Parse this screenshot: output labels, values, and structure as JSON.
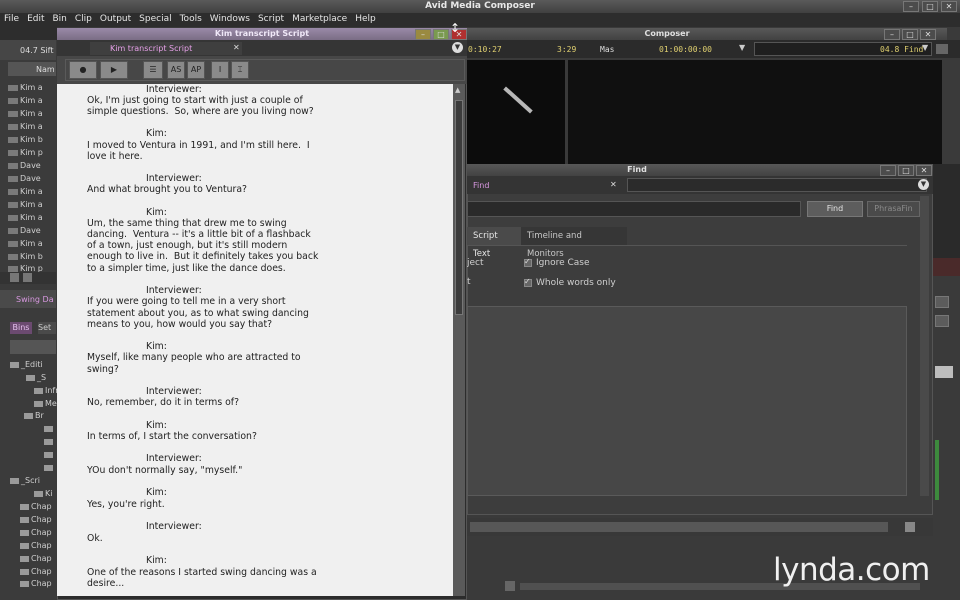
{
  "app": {
    "title": "Avid Media Composer"
  },
  "menu": [
    "File",
    "Edit",
    "Bin",
    "Clip",
    "Output",
    "Special",
    "Tools",
    "Windows",
    "Script",
    "Marketplace",
    "Help"
  ],
  "bin": {
    "header": "04.7 Sift",
    "col": "Nam",
    "items": [
      "Kim a",
      "Kim a",
      "Kim a",
      "Kim a",
      "Kim b",
      "Kim p",
      "Dave",
      "Dave",
      "Kim a",
      "Kim a",
      "Kim a",
      "Dave",
      "Kim a",
      "Kim b",
      "Kim p"
    ]
  },
  "project": {
    "title": "Swing Da",
    "tabs": [
      "Bins",
      "Set"
    ],
    "tree": [
      "_Editi",
      "_S",
      "Infr",
      "Me",
      "Br",
      "",
      "",
      "",
      "",
      "_Scri",
      "Ki",
      "Chap",
      "Chap",
      "Chap",
      "Chap",
      "Chap",
      "Chap",
      "Chap"
    ]
  },
  "script_window": {
    "title": "Kim transcript Script",
    "tab": "Kim transcript Script",
    "buttons": [
      "AS",
      "AP"
    ],
    "lines": [
      {
        "speaker": "Interviewer:",
        "text": [
          "Ok, I'm just going to start with just a couple of",
          "simple questions.  So, where are you living now?"
        ]
      },
      {
        "speaker": "Kim:",
        "text": [
          "I moved to Ventura in 1991, and I'm still here.  I",
          "love it here."
        ]
      },
      {
        "speaker": "Interviewer:",
        "text": [
          "And what brought you to Ventura?"
        ]
      },
      {
        "speaker": "Kim:",
        "text": [
          "Um, the same thing that drew me to swing",
          "dancing.  Ventura -- it's a little bit of a flashback",
          "of a town, just enough, but it's still modern",
          "enough to live in.  But it definitely takes you back",
          "to a simpler time, just like the dance does."
        ]
      },
      {
        "speaker": "Interviewer:",
        "text": [
          "If you were going to tell me in a very short",
          "statement about you, as to what swing dancing",
          "means to you, how would you say that?"
        ]
      },
      {
        "speaker": "Kim:",
        "text": [
          "Myself, like many people who are attracted to",
          "swing?"
        ]
      },
      {
        "speaker": "Interviewer:",
        "text": [
          "No, remember, do it in terms of?"
        ]
      },
      {
        "speaker": "Kim:",
        "text": [
          "In terms of, I start the conversation?"
        ]
      },
      {
        "speaker": "Interviewer:",
        "text": [
          "YOu don't normally say, \"myself.\""
        ]
      },
      {
        "speaker": "Kim:",
        "text": [
          "Yes, you're right."
        ]
      },
      {
        "speaker": "Interviewer:",
        "text": [
          "Ok."
        ]
      },
      {
        "speaker": "Kim:",
        "text": [
          "One of the reasons I started swing dancing was a",
          "desire..."
        ]
      }
    ]
  },
  "composer": {
    "title": "Composer",
    "tc1": "0:10:27",
    "tc2": "3:29",
    "tc3": "Mas",
    "tc4": "01:00:00:00",
    "right_label": "04.8 Find"
  },
  "find": {
    "title": "Find",
    "tab": "Find",
    "button_find": "Find",
    "button_phrase": "PhrasaFin",
    "tabs": [
      "Script Text",
      "Timeline and Monitors"
    ],
    "label_left1": "ject",
    "label_left2": "t",
    "options": [
      "Ignore Case",
      "Whole words only"
    ]
  },
  "watermark": "lynda.com",
  "colors": {
    "accent": "#d898e0",
    "timecode": "#e0d070"
  }
}
